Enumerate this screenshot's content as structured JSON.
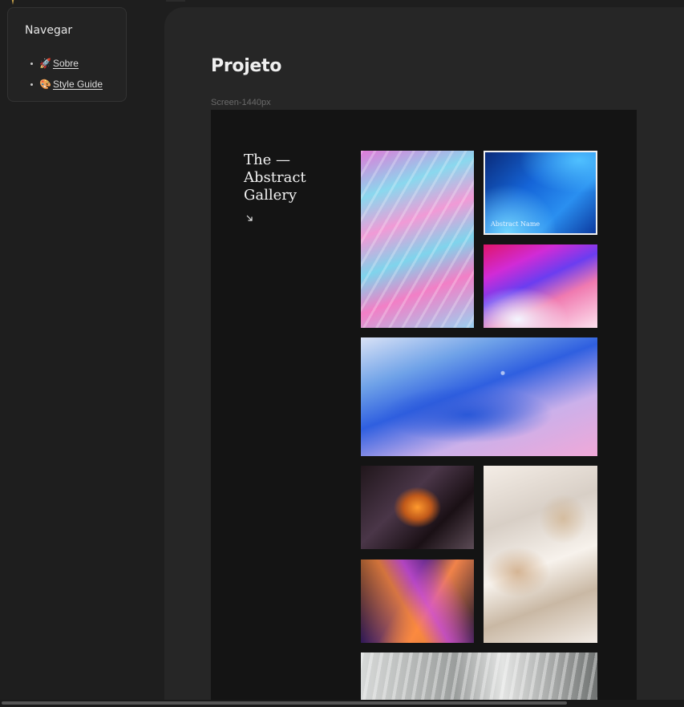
{
  "navigation": {
    "title": "Navegar",
    "items": [
      {
        "emoji": "🚀",
        "label": "Sobre"
      },
      {
        "emoji": "🎨",
        "label": "Style Guide"
      }
    ]
  },
  "page": {
    "title": "Projeto",
    "frame_label": "Screen-1440px"
  },
  "gallery": {
    "heading_lines": [
      "The —",
      "Abstract",
      "Gallery"
    ],
    "tiles": [
      {
        "caption": ""
      },
      {
        "caption": "Abstract Name"
      },
      {
        "caption": ""
      },
      {
        "caption": ""
      },
      {
        "caption": ""
      },
      {
        "caption": ""
      },
      {
        "caption": ""
      },
      {
        "caption": ""
      }
    ]
  },
  "icons": {
    "pin": "pin-icon",
    "arrow": "arrow-down-right-icon"
  },
  "colors": {
    "background": "#1e1e1e",
    "panel": "#262626",
    "frame": "#141414"
  }
}
